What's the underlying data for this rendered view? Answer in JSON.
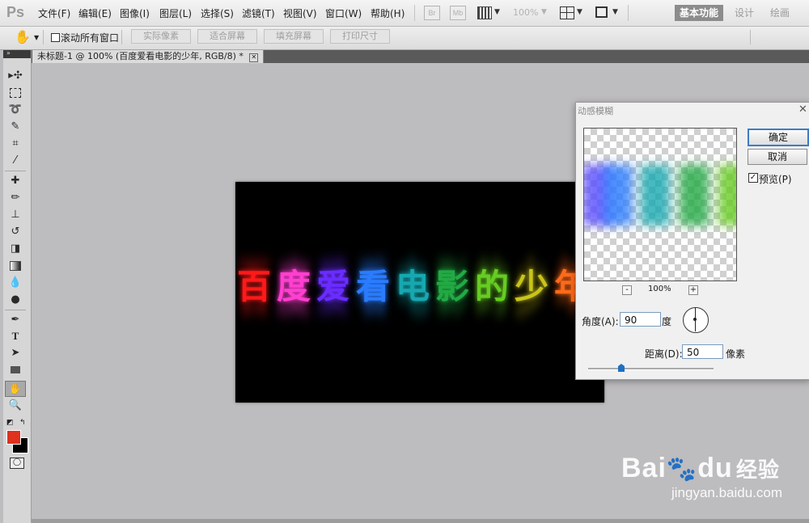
{
  "app": {
    "logo": "Ps"
  },
  "menu": [
    "文件(F)",
    "编辑(E)",
    "图像(I)",
    "图层(L)",
    "选择(S)",
    "滤镜(T)",
    "视图(V)",
    "窗口(W)",
    "帮助(H)"
  ],
  "menubar_icons": {
    "br": "Br",
    "mb": "Mb",
    "zoom": "100%"
  },
  "workspaces": [
    "基本功能",
    "设计",
    "绘画"
  ],
  "options": {
    "scroll_all_label": "滚动所有窗口",
    "buttons": [
      "实际像素",
      "适合屏幕",
      "填充屏幕",
      "打印尺寸"
    ]
  },
  "document": {
    "tab_title": "未标题-1 @ 100% (百度爱看电影的少年, RGB/8) *"
  },
  "canvas": {
    "glyphs": [
      {
        "ch": "百",
        "color": "#ff1a1a"
      },
      {
        "ch": "度",
        "color": "#ff3fd0"
      },
      {
        "ch": "爱",
        "color": "#6a2cff"
      },
      {
        "ch": "看",
        "color": "#2a7cff"
      },
      {
        "ch": "电",
        "color": "#16a8b0"
      },
      {
        "ch": "影",
        "color": "#22aa44"
      },
      {
        "ch": "的",
        "color": "#66cc22"
      },
      {
        "ch": "少",
        "color": "#c8c41a"
      },
      {
        "ch": "年",
        "color": "#ff6a1a"
      }
    ]
  },
  "dialog": {
    "title": "动感模糊",
    "ok_label": "确定",
    "cancel_label": "取消",
    "preview_label": "预览(P)",
    "preview_checked": true,
    "zoom_minus": "-",
    "zoom_plus": "+",
    "zoom_level": "100%",
    "angle_label": "角度(A):",
    "angle_value": "90",
    "angle_unit": "度",
    "distance_label": "距离(D):",
    "distance_value": "50",
    "distance_unit": "像素"
  },
  "colors": {
    "foreground": "#e0301e",
    "background": "#000000",
    "accent": "#1d6fc4"
  },
  "watermark": {
    "logo": "Bai du 经验",
    "url": "jingyan.baidu.com"
  }
}
